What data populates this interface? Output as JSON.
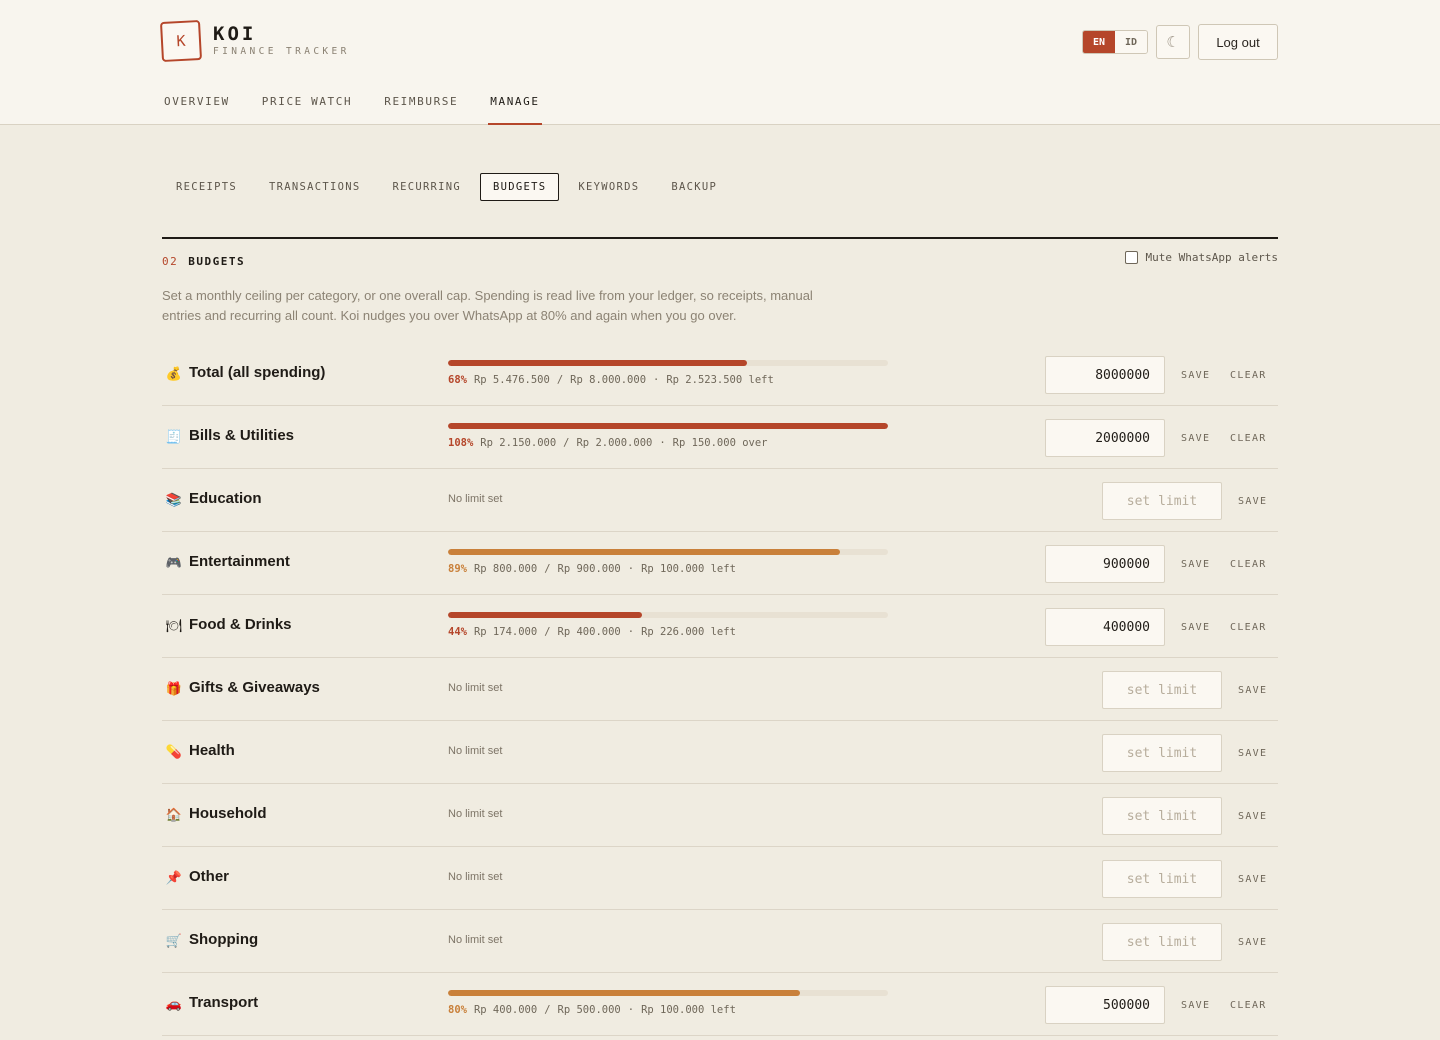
{
  "header": {
    "logo_letter": "K",
    "brand_name": "KOI",
    "brand_sub": "FINANCE TRACKER",
    "lang": [
      "EN",
      "ID"
    ],
    "active_lang": "EN",
    "theme_icon": "moon-icon",
    "logout_label": "Log out",
    "nav": [
      "OVERVIEW",
      "PRICE WATCH",
      "REIMBURSE",
      "MANAGE"
    ],
    "active_nav": "MANAGE"
  },
  "tabs": [
    "RECEIPTS",
    "TRANSACTIONS",
    "RECURRING",
    "BUDGETS",
    "KEYWORDS",
    "BACKUP"
  ],
  "active_tab": "BUDGETS",
  "section": {
    "number": "02",
    "title": "BUDGETS",
    "mute_label": "Mute WhatsApp alerts",
    "mute_checked": false,
    "description": "Set a monthly ceiling per category, or one overall cap. Spending is read live from your ledger, so receipts, manual entries and recurring all count. Koi nudges you over WhatsApp at 80% and again when you go over."
  },
  "labels": {
    "save": "SAVE",
    "clear": "CLEAR",
    "no_limit": "No limit set",
    "placeholder": "set limit"
  },
  "colors": {
    "accent": "#b5462a",
    "warning": "#c9803a",
    "background": "#f0ece1"
  },
  "budgets": [
    {
      "name": "Total (all spending)",
      "icon": "money-bag-icon",
      "glyph": "💰",
      "limit": "8000000",
      "pct_label": "68%",
      "fill": 0.68,
      "status": "danger",
      "detail": [
        "Rp 5.476.500",
        "/",
        "Rp 8.000.000",
        "·",
        "Rp 2.523.500 left"
      ]
    },
    {
      "name": "Bills & Utilities",
      "icon": "bill-icon",
      "glyph": "🧾",
      "limit": "2000000",
      "pct_label": "108%",
      "fill": 1.0,
      "status": "danger",
      "detail": [
        "Rp 2.150.000",
        "/",
        "Rp 2.000.000",
        "·",
        "Rp 150.000 over"
      ]
    },
    {
      "name": "Education",
      "icon": "books-icon",
      "glyph": "📚",
      "limit": null
    },
    {
      "name": "Entertainment",
      "icon": "gamepad-icon",
      "glyph": "🎮",
      "limit": "900000",
      "pct_label": "89%",
      "fill": 0.89,
      "status": "warning",
      "detail": [
        "Rp 800.000",
        "/",
        "Rp 900.000",
        "·",
        "Rp 100.000 left"
      ]
    },
    {
      "name": "Food & Drinks",
      "icon": "plate-icon",
      "glyph": "🍽",
      "limit": "400000",
      "pct_label": "44%",
      "fill": 0.44,
      "status": "danger",
      "detail": [
        "Rp 174.000",
        "/",
        "Rp 400.000",
        "·",
        "Rp 226.000 left"
      ]
    },
    {
      "name": "Gifts & Giveaways",
      "icon": "gift-icon",
      "glyph": "🎁",
      "limit": null
    },
    {
      "name": "Health",
      "icon": "pill-icon",
      "glyph": "💊",
      "limit": null
    },
    {
      "name": "Household",
      "icon": "house-icon",
      "glyph": "🏠",
      "limit": null
    },
    {
      "name": "Other",
      "icon": "pushpin-icon",
      "glyph": "📌",
      "limit": null
    },
    {
      "name": "Shopping",
      "icon": "cart-icon",
      "glyph": "🛒",
      "limit": null
    },
    {
      "name": "Transport",
      "icon": "car-icon",
      "glyph": "🚗",
      "limit": "500000",
      "pct_label": "80%",
      "fill": 0.8,
      "status": "warning",
      "detail": [
        "Rp 400.000",
        "/",
        "Rp 500.000",
        "·",
        "Rp 100.000 left"
      ]
    }
  ]
}
